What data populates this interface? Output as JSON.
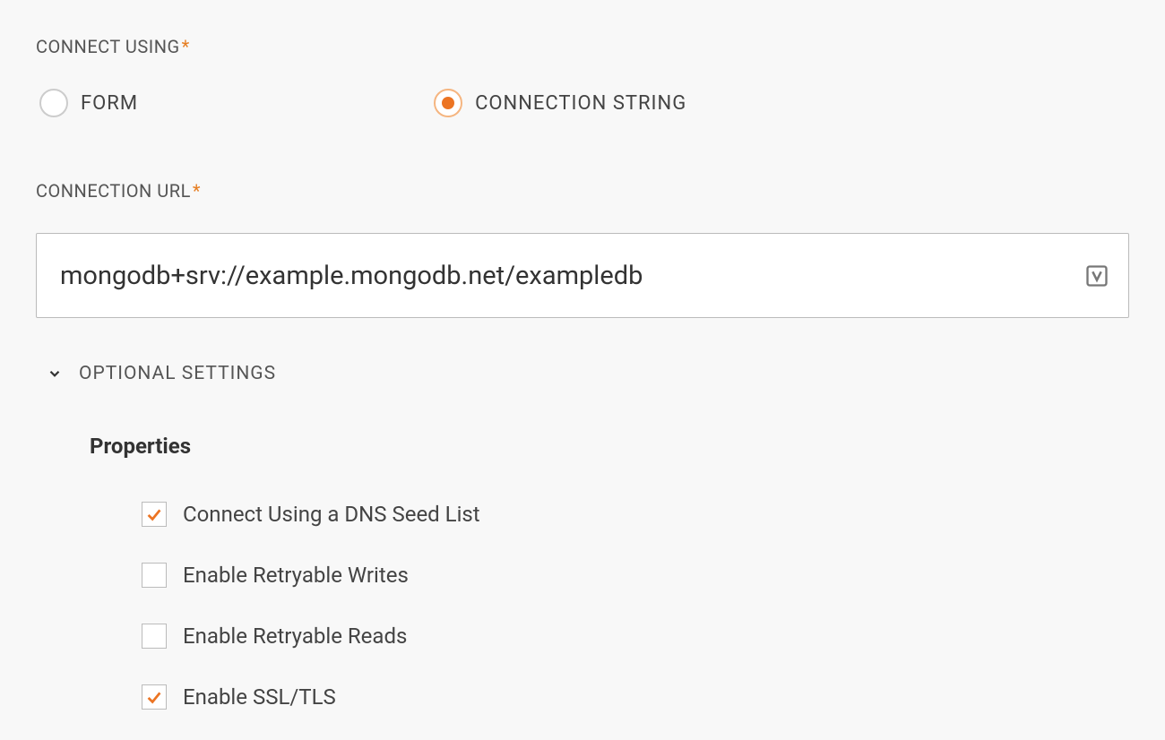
{
  "connectUsing": {
    "label": "CONNECT USING",
    "options": {
      "form": "FORM",
      "connectionString": "CONNECTION STRING"
    },
    "selected": "connectionString"
  },
  "connectionUrl": {
    "label": "CONNECTION URL",
    "value": "mongodb+srv://example.mongodb.net/exampledb"
  },
  "optionalSettings": {
    "label": "OPTIONAL SETTINGS",
    "properties": {
      "title": "Properties",
      "items": [
        {
          "label": "Connect Using a DNS Seed List",
          "checked": true
        },
        {
          "label": "Enable Retryable Writes",
          "checked": false
        },
        {
          "label": "Enable Retryable Reads",
          "checked": false
        },
        {
          "label": "Enable SSL/TLS",
          "checked": true
        }
      ]
    }
  }
}
